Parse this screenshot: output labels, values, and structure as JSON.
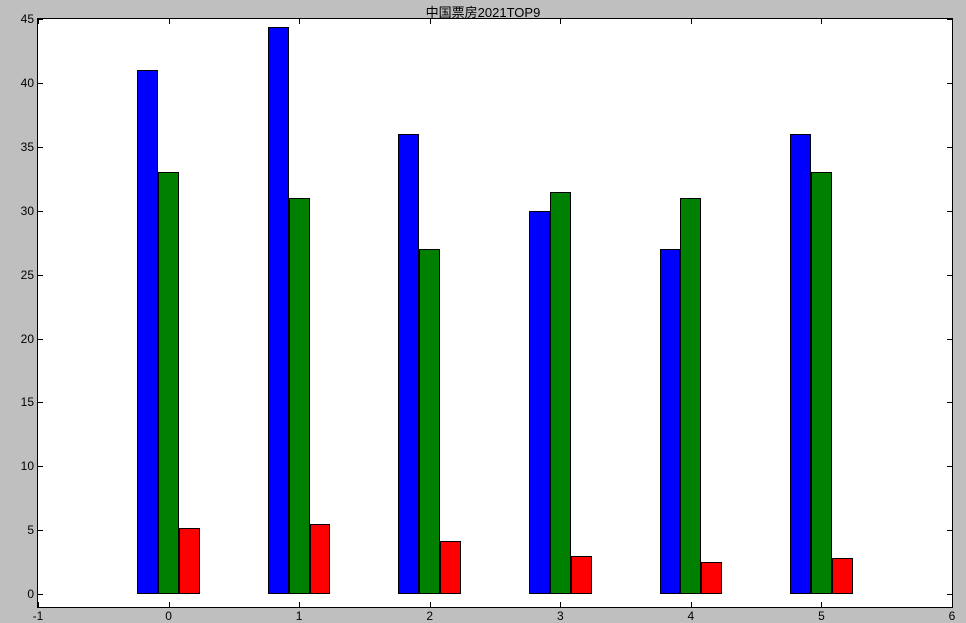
{
  "chart_data": {
    "type": "bar",
    "title": "中国票房2021TOP9",
    "xlabel": "",
    "ylabel": "",
    "categories": [
      0,
      1,
      2,
      3,
      4,
      5
    ],
    "series": [
      {
        "name": "blue",
        "color": "#0000ff",
        "values": [
          41,
          44.4,
          36,
          30,
          27,
          36
        ]
      },
      {
        "name": "green",
        "color": "#008000",
        "values": [
          33,
          31,
          27,
          31.5,
          31,
          33
        ]
      },
      {
        "name": "red",
        "color": "#ff0000",
        "values": [
          5.2,
          5.5,
          4.2,
          3.0,
          2.5,
          2.8
        ]
      }
    ],
    "xlim": [
      -1,
      6
    ],
    "ylim": [
      -1,
      45
    ],
    "xticks": [
      -1,
      0,
      1,
      2,
      3,
      4,
      5,
      6
    ],
    "yticks": [
      0,
      5,
      10,
      15,
      20,
      25,
      30,
      35,
      40,
      45
    ]
  }
}
